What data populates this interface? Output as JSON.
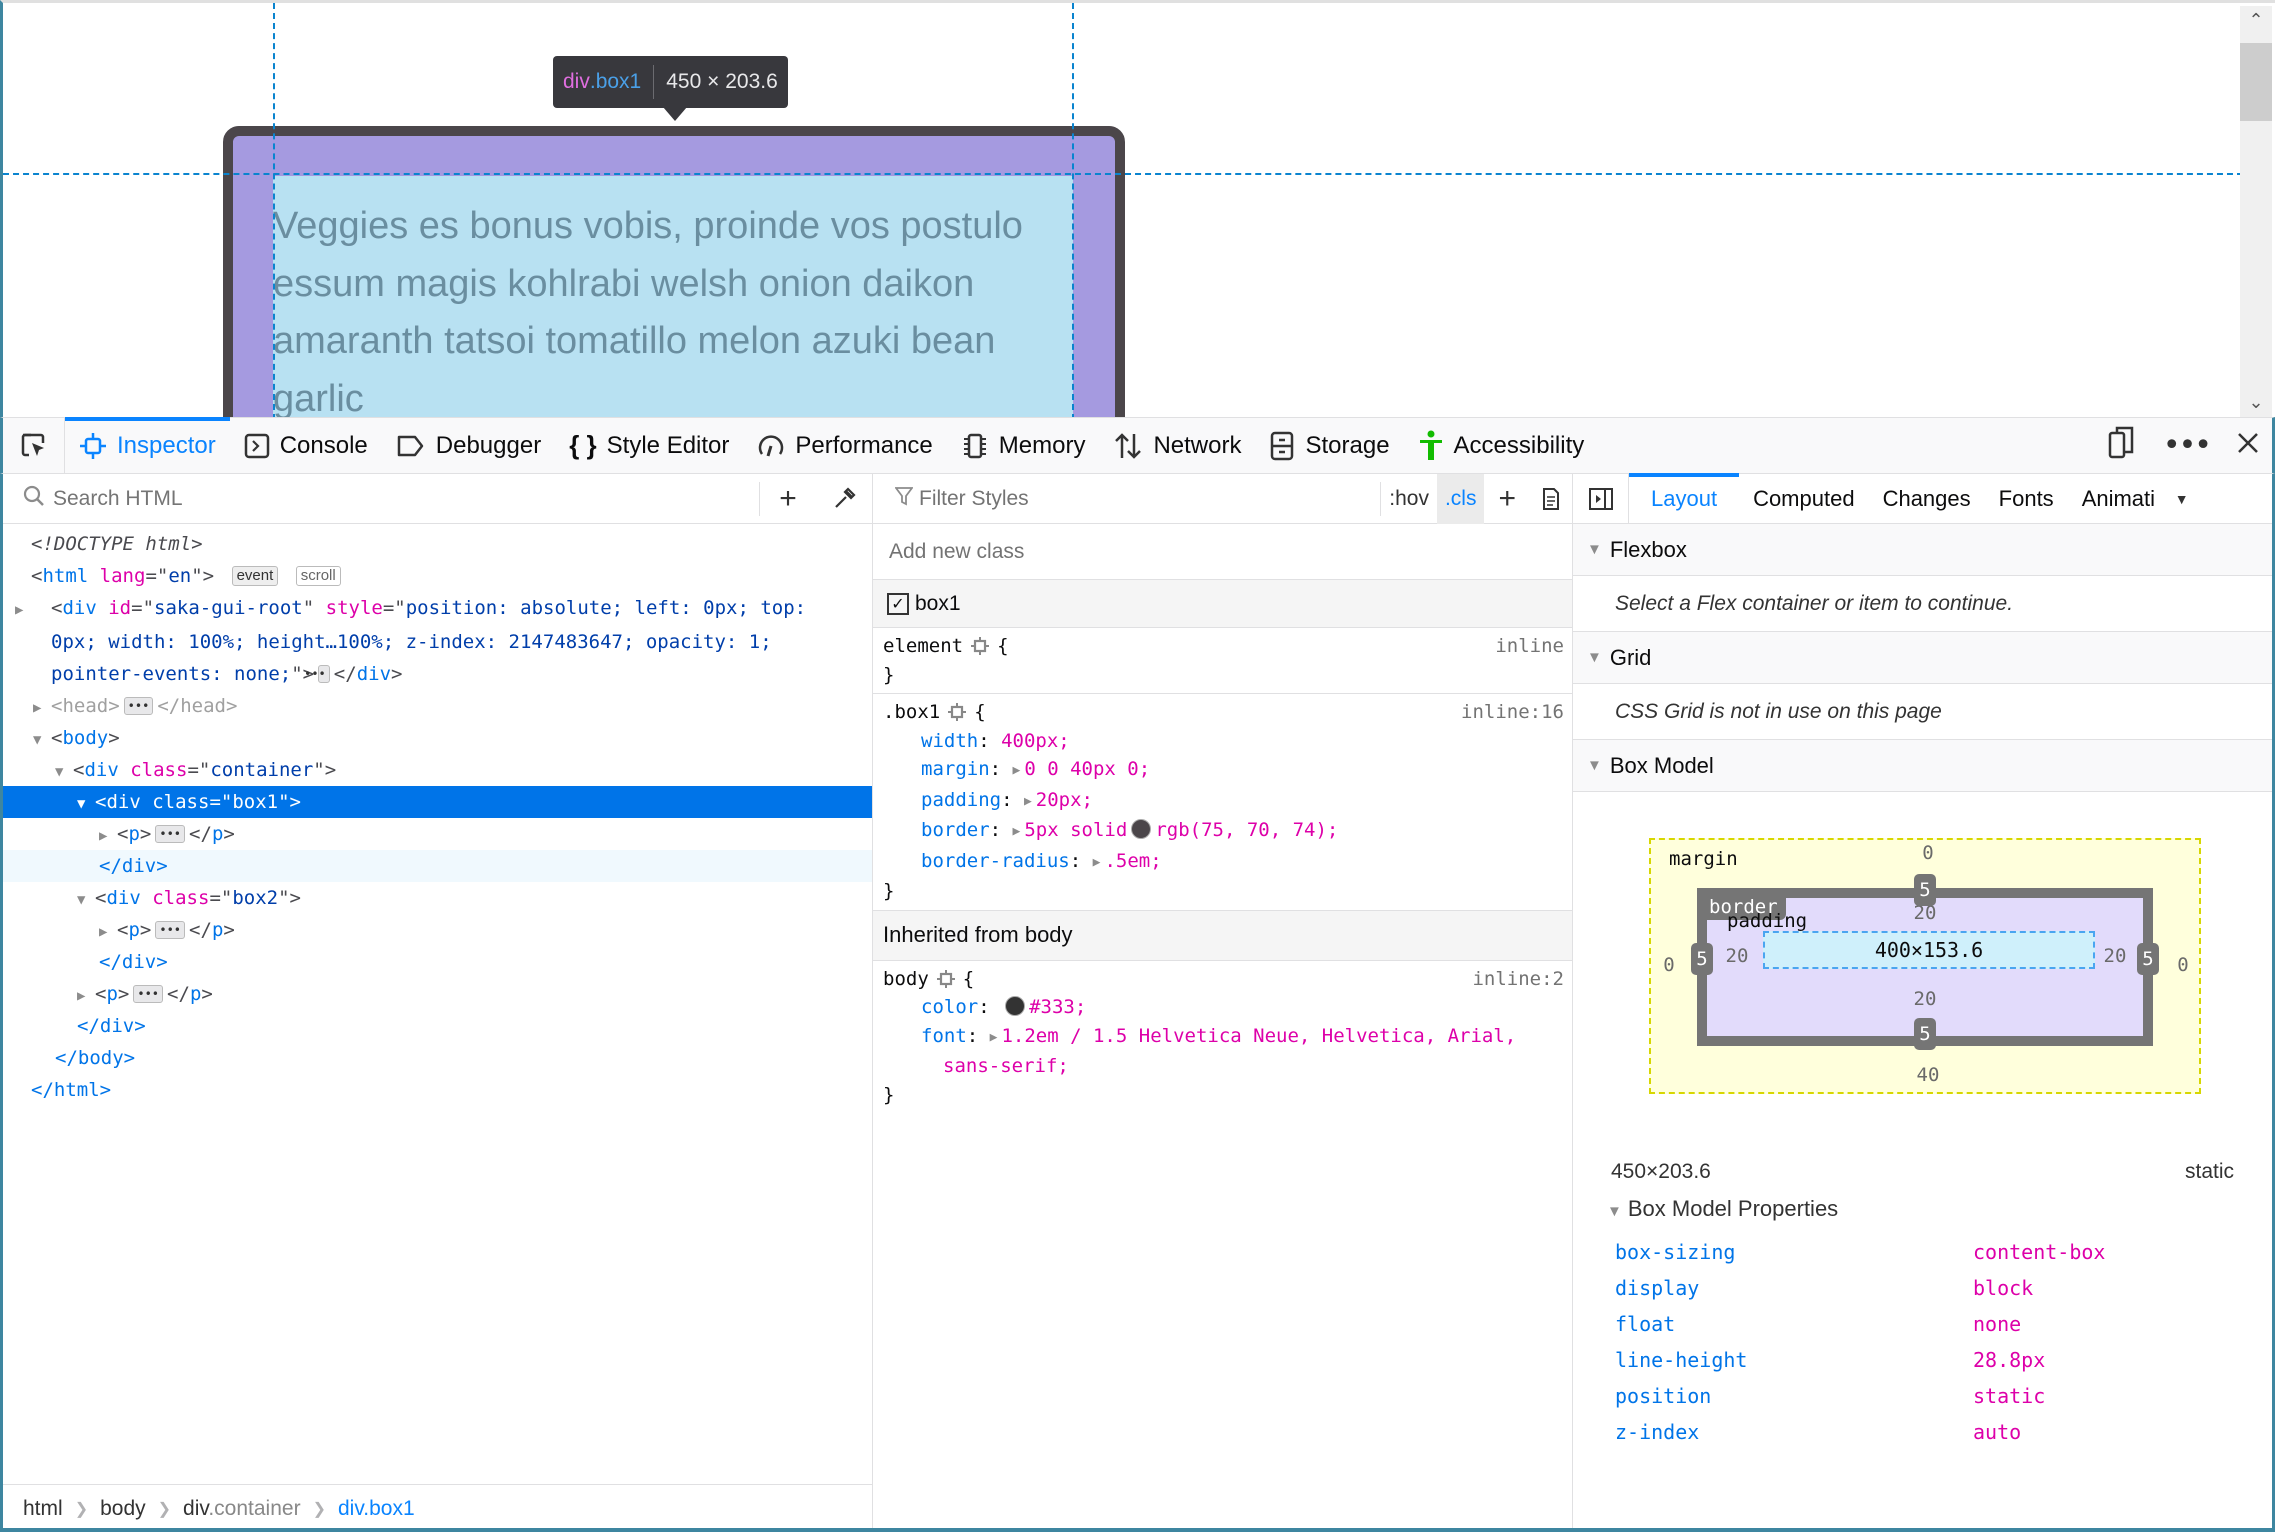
{
  "viewport": {
    "paragraph": "Veggies es bonus vobis, proinde vos postulo essum magis kohlrabi welsh onion daikon amaranth tatsoi tomatillo melon azuki bean garlic",
    "infobar": {
      "tag": "div",
      "class": ".box1",
      "size": "450 × 203.6"
    }
  },
  "toolbar": {
    "tabs": [
      {
        "label": "Inspector",
        "icon": "inspector-icon",
        "active": true
      },
      {
        "label": "Console",
        "icon": "console-icon"
      },
      {
        "label": "Debugger",
        "icon": "debugger-icon"
      },
      {
        "label": "Style Editor",
        "icon": "style-editor-icon"
      },
      {
        "label": "Performance",
        "icon": "performance-icon"
      },
      {
        "label": "Memory",
        "icon": "memory-icon"
      },
      {
        "label": "Network",
        "icon": "network-icon"
      },
      {
        "label": "Storage",
        "icon": "storage-icon"
      },
      {
        "label": "Accessibility",
        "icon": "accessibility-icon"
      }
    ],
    "accessibility_color": "#12bc00",
    "accent_color": "#0a84ff"
  },
  "markup": {
    "search_placeholder": "Search HTML",
    "doctype": "<!DOCTYPE html>",
    "html_open": {
      "tag": "html",
      "attr": "lang",
      "value": "en"
    },
    "badges": [
      "event",
      "scroll"
    ],
    "root_div": {
      "id": "saka-gui-root",
      "style": "position: absolute; left: 0px; top: 0px; width: 100%; height…100%; z-index: 2147483647; opacity: 1; pointer-events: none;"
    },
    "head": "head",
    "body": "body",
    "container_class": "container",
    "box1_class": "box1",
    "box2_class": "box2",
    "p_tag": "p",
    "div_close": "</div>",
    "body_close": "</body>",
    "html_close": "</html>"
  },
  "breadcrumb": [
    {
      "tag": "html",
      "cls": ""
    },
    {
      "tag": "body",
      "cls": ""
    },
    {
      "tag": "div",
      "cls": ".container"
    },
    {
      "tag": "div",
      "cls": ".box1",
      "active": true
    }
  ],
  "rules": {
    "filter_placeholder": "Filter Styles",
    "hov": ":hov",
    "cls": ".cls",
    "add_class_placeholder": "Add new class",
    "class_toggle": "box1",
    "element_rule": {
      "selector": "element",
      "source": "inline"
    },
    "box1_rule": {
      "selector": ".box1",
      "source": "inline:16",
      "decls": [
        {
          "name": "width",
          "value": "400px;"
        },
        {
          "name": "margin",
          "value": "0 0 40px 0;",
          "expandable": true
        },
        {
          "name": "padding",
          "value": "20px;",
          "expandable": true
        },
        {
          "name": "border",
          "value": "5px solid",
          "color": "rgb(75, 70, 74)",
          "value2": "rgb(75, 70, 74);",
          "expandable": true
        },
        {
          "name": "border-radius",
          "value": ".5em;",
          "expandable": true
        }
      ]
    },
    "inherited_header": "Inherited from body",
    "body_rule": {
      "selector": "body",
      "source": "inline:2",
      "decls": [
        {
          "name": "color",
          "value": "#333;",
          "color": "#333333"
        },
        {
          "name": "font",
          "value": "1.2em / 1.5 Helvetica Neue, Helvetica, Arial,",
          "value_cont": "sans-serif;"
        }
      ]
    }
  },
  "sidebar": {
    "tabs": [
      "Layout",
      "Computed",
      "Changes",
      "Fonts",
      "Animati"
    ],
    "active_tab": "Layout",
    "flexbox": {
      "title": "Flexbox",
      "message": "Select a Flex container or item to continue."
    },
    "grid": {
      "title": "Grid",
      "message": "CSS Grid is not in use on this page"
    },
    "box_model": {
      "title": "Box Model",
      "margin_label": "margin",
      "border_label": "border",
      "padding_label": "padding",
      "margin": {
        "top": "0",
        "right": "0",
        "bottom": "40",
        "left": "0"
      },
      "border": {
        "top": "5",
        "right": "5",
        "bottom": "5",
        "left": "5"
      },
      "padding": {
        "top": "20",
        "right": "20",
        "bottom": "20",
        "left": "20"
      },
      "content": "400×153.6",
      "dimensions": "450×203.6",
      "position": "static"
    },
    "properties": {
      "title": "Box Model Properties",
      "rows": [
        {
          "name": "box-sizing",
          "value": "content-box"
        },
        {
          "name": "display",
          "value": "block"
        },
        {
          "name": "float",
          "value": "none"
        },
        {
          "name": "line-height",
          "value": "28.8px"
        },
        {
          "name": "position",
          "value": "static"
        },
        {
          "name": "z-index",
          "value": "auto"
        }
      ]
    }
  }
}
